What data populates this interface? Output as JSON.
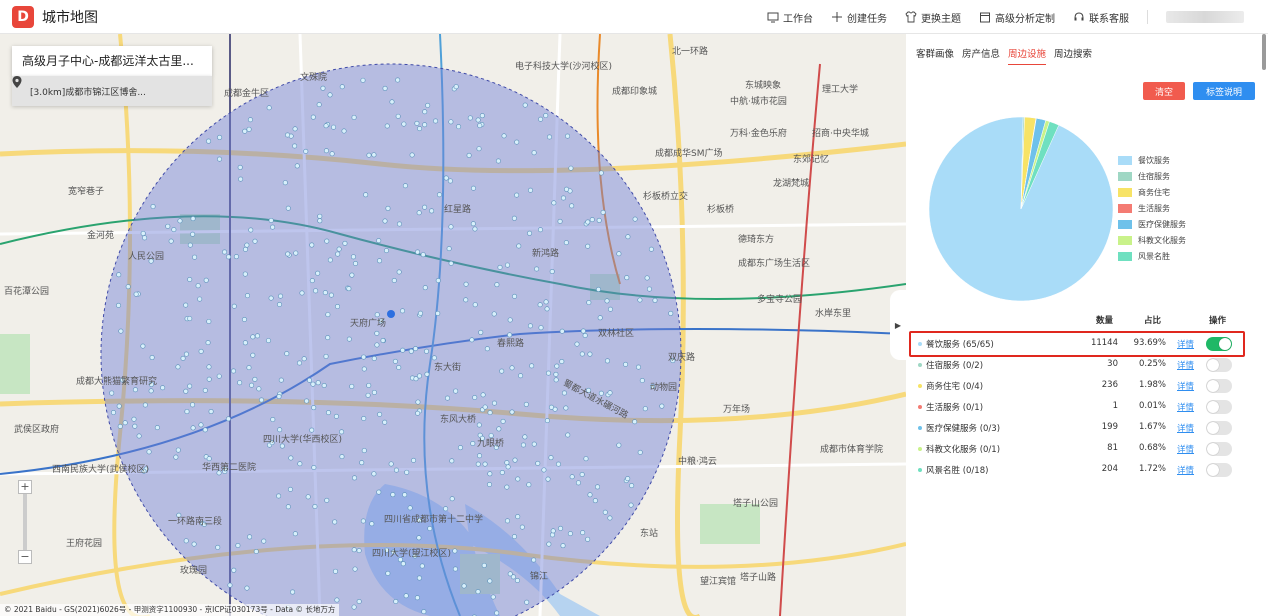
{
  "header": {
    "logo_letter": "D",
    "title": "城市地图",
    "nav": [
      {
        "label": "工作台",
        "icon": "monitor-icon"
      },
      {
        "label": "创建任务",
        "icon": "plus-icon"
      },
      {
        "label": "更换主题",
        "icon": "shirt-icon"
      },
      {
        "label": "高级分析定制",
        "icon": "calendar-icon"
      },
      {
        "label": "联系客服",
        "icon": "headset-icon"
      }
    ]
  },
  "map": {
    "search_title": "高级月子中心-成都远洋太古里...",
    "sub_item": "[3.0km]成都市锦江区博舍...",
    "copyright": "© 2021 Baidu - GS(2021)6026号 - 甲测资字1100930 - 京ICP证030173号 - Data © 长地万方",
    "labels": [
      {
        "t": "电子科技大学(沙河校区)"
      },
      {
        "t": "成都印象城"
      },
      {
        "t": "东城映象"
      },
      {
        "t": "中航·城市花园"
      },
      {
        "t": "理工大学"
      },
      {
        "t": "万科·金色乐府"
      },
      {
        "t": "招商·中央华城"
      },
      {
        "t": "成都成华SM广场"
      },
      {
        "t": "东郊记忆"
      },
      {
        "t": "龙湖梵城"
      },
      {
        "t": "杉板桥立交"
      },
      {
        "t": "杉板桥"
      },
      {
        "t": "德琦东方"
      },
      {
        "t": "成都东广场生活区"
      },
      {
        "t": "多宝寺公园"
      },
      {
        "t": "水岸东里"
      },
      {
        "t": "万年场"
      },
      {
        "t": "成都市体育学院"
      },
      {
        "t": "中粮·鸿云"
      },
      {
        "t": "塔子山公园"
      },
      {
        "t": "东站"
      },
      {
        "t": "望江宾馆"
      },
      {
        "t": "塔子山路"
      },
      {
        "t": "四川大学(华西校区)"
      },
      {
        "t": "华西第二医院"
      },
      {
        "t": "西南民族大学(武侯校区)"
      },
      {
        "t": "武侯区政府"
      },
      {
        "t": "一环路南三段"
      },
      {
        "t": "王府花园"
      },
      {
        "t": "玫瑰园"
      },
      {
        "t": "成都大熊猫繁育研究"
      },
      {
        "t": "人民公园"
      },
      {
        "t": "宽窄巷子"
      },
      {
        "t": "金河苑"
      },
      {
        "t": "百花潭公园"
      },
      {
        "t": "四川省成都市第十二中学"
      },
      {
        "t": "四川大学(望江校区)"
      },
      {
        "t": "九眼桥"
      },
      {
        "t": "锦江"
      },
      {
        "t": "天府广场"
      },
      {
        "t": "春熙路"
      },
      {
        "t": "新鸿路"
      },
      {
        "t": "双林社区"
      },
      {
        "t": "东大街"
      },
      {
        "t": "蜀都大道水碾河路"
      },
      {
        "t": "东风大桥"
      },
      {
        "t": "红星路"
      },
      {
        "t": "文殊院"
      },
      {
        "t": "成都金牛区"
      },
      {
        "t": "双庆路"
      },
      {
        "t": "动物园"
      },
      {
        "t": "北一环路"
      }
    ]
  },
  "panel": {
    "tabs": [
      "客群画像",
      "房产信息",
      "周边设施",
      "周边搜索"
    ],
    "active_tab": 2,
    "clear_label": "清空",
    "legend_btn_label": "标签说明",
    "legend": [
      {
        "label": "餐饮服务",
        "color": "#a9dcf8"
      },
      {
        "label": "住宿服务",
        "color": "#9fd7c4"
      },
      {
        "label": "商务住宅",
        "color": "#f7e366"
      },
      {
        "label": "生活服务",
        "color": "#f47b73"
      },
      {
        "label": "医疗保健服务",
        "color": "#6ec1ea"
      },
      {
        "label": "科教文化服务",
        "color": "#c9f28a"
      },
      {
        "label": "风景名胜",
        "color": "#6fe0c0"
      }
    ],
    "table_headers": {
      "count": "数量",
      "pct": "占比",
      "op": "操作"
    },
    "rows": [
      {
        "name": "餐饮服务 (65/65)",
        "count": "11144",
        "pct": "93.69%",
        "detail": "详情",
        "color": "#a9dcf8",
        "on": true,
        "share": 93.69
      },
      {
        "name": "住宿服务 (0/2)",
        "count": "30",
        "pct": "0.25%",
        "detail": "详情",
        "color": "#9fd7c4",
        "on": false,
        "share": 0.25
      },
      {
        "name": "商务住宅 (0/4)",
        "count": "236",
        "pct": "1.98%",
        "detail": "详情",
        "color": "#f7e366",
        "on": false,
        "share": 1.98
      },
      {
        "name": "生活服务 (0/1)",
        "count": "1",
        "pct": "0.01%",
        "detail": "详情",
        "color": "#f47b73",
        "on": false,
        "share": 0.01
      },
      {
        "name": "医疗保健服务 (0/3)",
        "count": "199",
        "pct": "1.67%",
        "detail": "详情",
        "color": "#6ec1ea",
        "on": false,
        "share": 1.67
      },
      {
        "name": "科教文化服务 (0/1)",
        "count": "81",
        "pct": "0.68%",
        "detail": "详情",
        "color": "#c9f28a",
        "on": false,
        "share": 0.68
      },
      {
        "name": "风景名胜 (0/18)",
        "count": "204",
        "pct": "1.72%",
        "detail": "详情",
        "color": "#6fe0c0",
        "on": false,
        "share": 1.72
      }
    ]
  }
}
